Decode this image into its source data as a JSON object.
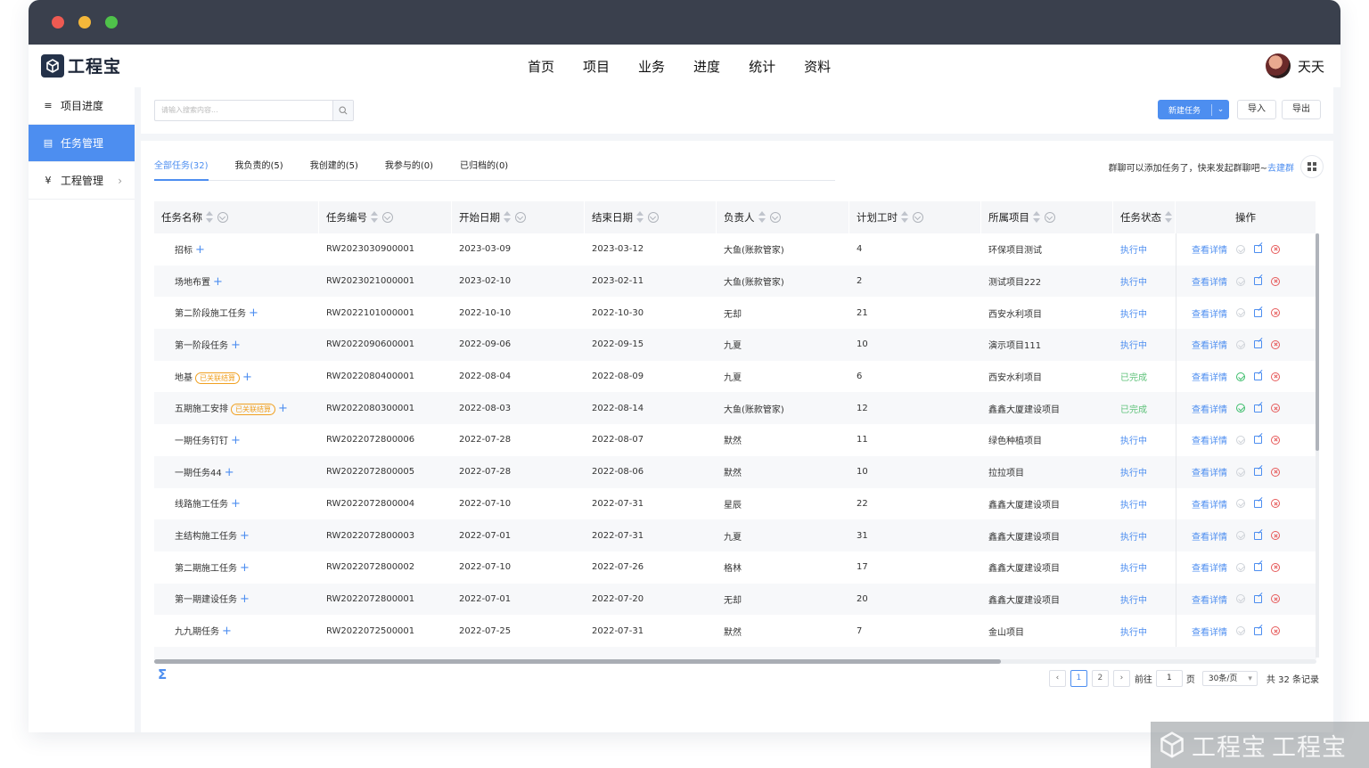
{
  "app": {
    "name": "工程宝"
  },
  "topnav": [
    "首页",
    "项目",
    "业务",
    "进度",
    "统计",
    "资料"
  ],
  "user": {
    "name": "天天"
  },
  "sidebar": {
    "items": [
      {
        "label": "项目进度"
      },
      {
        "label": "任务管理"
      },
      {
        "label": "工程管理"
      }
    ]
  },
  "toolbar": {
    "search_placeholder": "请输入搜索内容...",
    "new_task": "新建任务",
    "import": "导入",
    "export": "导出"
  },
  "tabs": [
    "全部任务(32)",
    "我负责的(5)",
    "我创建的(5)",
    "我参与的(0)",
    "已归档的(0)"
  ],
  "notice": {
    "text": "群聊可以添加任务了，快来发起群聊吧~",
    "link": "去建群"
  },
  "table": {
    "headers": [
      "任务名称",
      "任务编号",
      "开始日期",
      "结束日期",
      "负责人",
      "计划工时",
      "所属项目",
      "任务状态",
      "操作"
    ],
    "view_label": "查看详情",
    "rows": [
      {
        "name": "招标",
        "tag": "",
        "code": "RW2023030900001",
        "start": "2023-03-09",
        "end": "2023-03-12",
        "owner": "大鱼(账款管家)",
        "hours": "4",
        "project": "环保项目测试",
        "status": "执行中",
        "done": false
      },
      {
        "name": "场地布置",
        "tag": "",
        "code": "RW2023021000001",
        "start": "2023-02-10",
        "end": "2023-02-11",
        "owner": "大鱼(账款管家)",
        "hours": "2",
        "project": "测试项目222",
        "status": "执行中",
        "done": false
      },
      {
        "name": "第二阶段施工任务",
        "tag": "",
        "code": "RW2022101000001",
        "start": "2022-10-10",
        "end": "2022-10-30",
        "owner": "无却",
        "hours": "21",
        "project": "西安水利项目",
        "status": "执行中",
        "done": false
      },
      {
        "name": "第一阶段任务",
        "tag": "",
        "code": "RW2022090600001",
        "start": "2022-09-06",
        "end": "2022-09-15",
        "owner": "九夏",
        "hours": "10",
        "project": "演示项目111",
        "status": "执行中",
        "done": false
      },
      {
        "name": "地基",
        "tag": "已关联结算",
        "code": "RW2022080400001",
        "start": "2022-08-04",
        "end": "2022-08-09",
        "owner": "九夏",
        "hours": "6",
        "project": "西安水利项目",
        "status": "已完成",
        "done": true
      },
      {
        "name": "五期施工安排",
        "tag": "已关联结算",
        "code": "RW2022080300001",
        "start": "2022-08-03",
        "end": "2022-08-14",
        "owner": "大鱼(账款管家)",
        "hours": "12",
        "project": "鑫鑫大厦建设项目",
        "status": "已完成",
        "done": true
      },
      {
        "name": "一期任务钉钉",
        "tag": "",
        "code": "RW2022072800006",
        "start": "2022-07-28",
        "end": "2022-08-07",
        "owner": "默然",
        "hours": "11",
        "project": "绿色种植项目",
        "status": "执行中",
        "done": false
      },
      {
        "name": "一期任务44",
        "tag": "",
        "code": "RW2022072800005",
        "start": "2022-07-28",
        "end": "2022-08-06",
        "owner": "默然",
        "hours": "10",
        "project": "拉拉项目",
        "status": "执行中",
        "done": false
      },
      {
        "name": "线路施工任务",
        "tag": "",
        "code": "RW2022072800004",
        "start": "2022-07-10",
        "end": "2022-07-31",
        "owner": "星辰",
        "hours": "22",
        "project": "鑫鑫大厦建设项目",
        "status": "执行中",
        "done": false
      },
      {
        "name": "主结构施工任务",
        "tag": "",
        "code": "RW2022072800003",
        "start": "2022-07-01",
        "end": "2022-07-31",
        "owner": "九夏",
        "hours": "31",
        "project": "鑫鑫大厦建设项目",
        "status": "执行中",
        "done": false
      },
      {
        "name": "第二期施工任务",
        "tag": "",
        "code": "RW2022072800002",
        "start": "2022-07-10",
        "end": "2022-07-26",
        "owner": "格林",
        "hours": "17",
        "project": "鑫鑫大厦建设项目",
        "status": "执行中",
        "done": false
      },
      {
        "name": "第一期建设任务",
        "tag": "",
        "code": "RW2022072800001",
        "start": "2022-07-01",
        "end": "2022-07-20",
        "owner": "无却",
        "hours": "20",
        "project": "鑫鑫大厦建设项目",
        "status": "执行中",
        "done": false
      },
      {
        "name": "九九期任务",
        "tag": "",
        "code": "RW2022072500001",
        "start": "2022-07-25",
        "end": "2022-07-31",
        "owner": "默然",
        "hours": "7",
        "project": "金山项目",
        "status": "执行中",
        "done": false
      }
    ]
  },
  "summary_icon": "Σ",
  "pager": {
    "pages": [
      "1",
      "2"
    ],
    "current": "1",
    "goto_prefix": "前往",
    "goto_value": "1",
    "goto_suffix": "页",
    "page_size": "30条/页",
    "total": "共 32 条记录"
  },
  "watermark": {
    "text1": "工程宝",
    "text2": "工程宝"
  },
  "colors": {
    "accent": "#4d8ef0",
    "titlebar": "#3a404d",
    "done": "#5fc27a",
    "danger": "#e65a5a"
  }
}
